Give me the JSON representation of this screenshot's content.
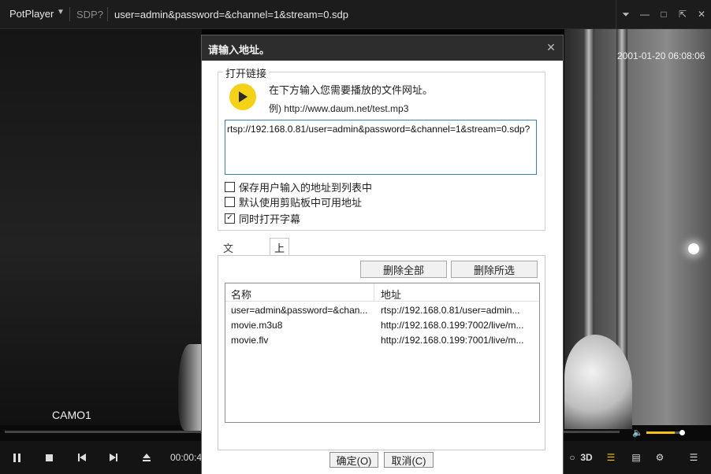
{
  "titlebar": {
    "app_name": "PotPlayer",
    "app_menu_icon": "chevron-down-icon",
    "format_tag": "SDP?",
    "file_title": "user=admin&password=&channel=1&stream=0.sdp",
    "controls": [
      "pin-icon",
      "minimize-icon",
      "maximize-icon",
      "fullscreen-icon",
      "close-icon"
    ]
  },
  "video": {
    "osd_timestamp": "2001-01-20 06:08:06",
    "osd_camera": "CAMO1"
  },
  "controlbar": {
    "time_partial": "00:00:4",
    "buttons_left": [
      "pause-icon",
      "stop-icon",
      "prev-icon",
      "next-icon",
      "eject-icon"
    ],
    "right_label_3d": "3D",
    "volume_level": 0.75,
    "accent_color": "#f2c21b"
  },
  "dialog": {
    "title": "请输入地址。",
    "group_label": "打开链接",
    "hint_line1": "在下方输入您需要播放的文件网址。",
    "hint_line2": "例) http://www.daum.net/test.mp3",
    "url_value": "rtsp://192.168.0.81/user=admin&password=&channel=1&stream=0.sdp?",
    "checkboxes": [
      {
        "label": "保存用户输入的地址到列表中",
        "checked": false
      },
      {
        "label": "默认使用剪贴板中可用地址",
        "checked": false
      },
      {
        "label": "同时打开字幕",
        "checked": true
      }
    ],
    "tabs": [
      {
        "label": "文件地址",
        "active": false
      },
      {
        "label": "上一地址",
        "active": true
      }
    ],
    "delete_all_label": "删除全部",
    "delete_selected_label": "删除所选",
    "list_columns": [
      "名称",
      "地址"
    ],
    "list_rows": [
      {
        "name": "user=admin&password=&chan...",
        "address": "rtsp://192.168.0.81/user=admin..."
      },
      {
        "name": "movie.m3u8",
        "address": "http://192.168.0.199:7002/live/m..."
      },
      {
        "name": "movie.flv",
        "address": "http://192.168.0.199:7001/live/m..."
      }
    ],
    "ok_label": "确定(O)",
    "cancel_label": "取消(C)",
    "play_icon_color": "#f4d218"
  }
}
